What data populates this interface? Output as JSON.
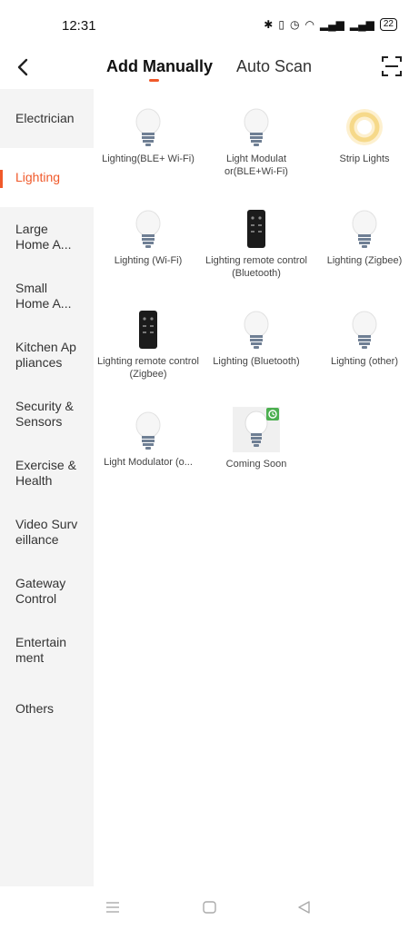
{
  "status_bar": {
    "time": "12:31",
    "battery": "22"
  },
  "header": {
    "tabs": [
      {
        "label": "Add Manually",
        "active": true
      },
      {
        "label": "Auto Scan",
        "active": false
      }
    ]
  },
  "sidebar": {
    "items": [
      {
        "label": "Electrician"
      },
      {
        "label": "Lighting",
        "active": true
      },
      {
        "label": "Large Home A..."
      },
      {
        "label": "Small Home A..."
      },
      {
        "label": "Kitchen Ap pliances"
      },
      {
        "label": "Security & Sensors"
      },
      {
        "label": "Exercise & Health"
      },
      {
        "label": "Video Surv eillance"
      },
      {
        "label": "Gateway Control"
      },
      {
        "label": "Entertain ment"
      },
      {
        "label": "Others"
      }
    ]
  },
  "devices": [
    {
      "label": "Lighting(BLE+ Wi-Fi)",
      "icon": "bulb"
    },
    {
      "label": "Light Modulat or(BLE+Wi-Fi)",
      "icon": "bulb"
    },
    {
      "label": "Strip Lights",
      "icon": "strip-light"
    },
    {
      "label": "Lighting (Wi-Fi)",
      "icon": "bulb"
    },
    {
      "label": "Lighting remote control (Bluetooth)",
      "icon": "remote"
    },
    {
      "label": "Lighting (Zigbee)",
      "icon": "bulb"
    },
    {
      "label": "Lighting remote control (Zigbee)",
      "icon": "remote"
    },
    {
      "label": "Lighting (Bluetooth)",
      "icon": "bulb"
    },
    {
      "label": "Lighting (other)",
      "icon": "bulb"
    },
    {
      "label": "Light Modulator (o...",
      "icon": "bulb"
    },
    {
      "label": "Coming Soon",
      "icon": "bulb-coming-soon"
    }
  ],
  "colors": {
    "accent": "#f0592a",
    "sidebar_bg": "#f4f4f4",
    "badge": "#4caf50"
  }
}
